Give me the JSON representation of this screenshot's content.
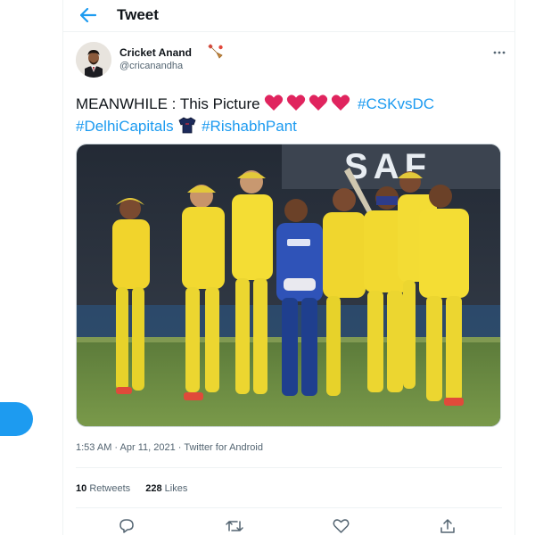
{
  "header": {
    "title": "Tweet",
    "back_icon": "arrow-left-icon"
  },
  "tweet": {
    "author": {
      "display_name": "Cricket Anand",
      "handle": "@cricanandha",
      "name_emoji": "cricket-bat-icon"
    },
    "text_prefix": "MEANWHILE : This Picture",
    "hearts": [
      "red-heart-icon",
      "red-heart-icon",
      "red-heart-icon",
      "red-heart-icon"
    ],
    "hashtags": [
      "#CSKvsDC",
      "#DelhiCapitals",
      "#RishabhPant"
    ],
    "jersey_emoji": "jersey-icon",
    "image_banner": "SAF",
    "time": "1:53 AM",
    "separator": "·",
    "date": "Apr 11, 2021",
    "source": "Twitter for Android",
    "retweets_count": "10",
    "retweets_label": "Retweets",
    "likes_count": "228",
    "likes_label": "Likes"
  },
  "actions": [
    "reply-icon",
    "retweet-icon",
    "like-icon",
    "share-icon"
  ],
  "colors": {
    "accent": "#1d9bf0",
    "heart": "#e0245e",
    "text": "#0f1419",
    "muted": "#536471",
    "border": "#eff3f4"
  }
}
